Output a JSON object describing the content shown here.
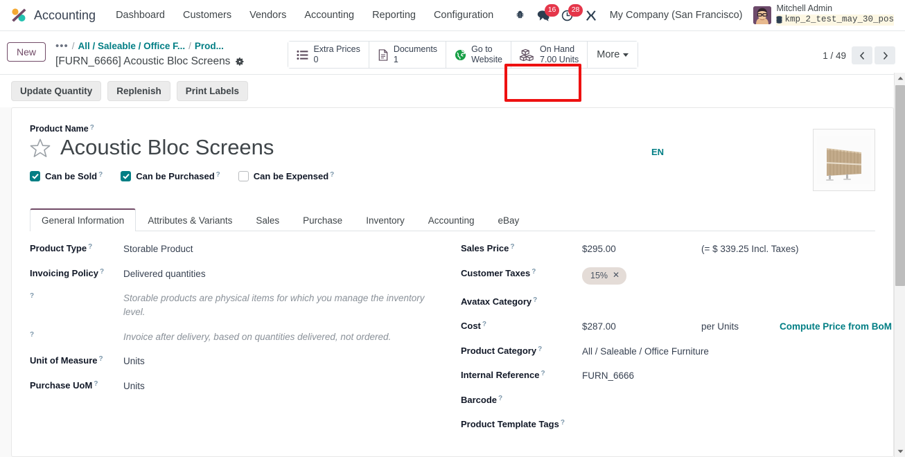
{
  "navbar": {
    "brand": "Accounting",
    "menu_items": [
      "Dashboard",
      "Customers",
      "Vendors",
      "Accounting",
      "Reporting",
      "Configuration"
    ],
    "icons": [
      {
        "name": "bug-icon",
        "badge": null
      },
      {
        "name": "chat-bubble-icon",
        "badge": "16"
      },
      {
        "name": "activity-clock-icon",
        "badge": "28"
      },
      {
        "name": "tools-icon",
        "badge": null
      }
    ],
    "company": "My Company (San Francisco)",
    "user_name": "Mitchell Admin",
    "database": "kmp_2_test_may_30_pos"
  },
  "control_panel": {
    "new_button": "New",
    "breadcrumb": {
      "dots": "•••",
      "items": [
        "All / Saleable / Office F...",
        "Prod..."
      ],
      "separator": "/",
      "record_title": "[FURN_6666] Acoustic Bloc Screens"
    },
    "stat_buttons": [
      {
        "name": "extra-prices",
        "icon": "list-icon",
        "label": "Extra Prices",
        "value": "0"
      },
      {
        "name": "documents",
        "icon": "document-icon",
        "label": "Documents",
        "value": "1"
      },
      {
        "name": "go-to-website",
        "icon": "globe-icon",
        "label": "Go to",
        "value": "Website"
      },
      {
        "name": "on-hand",
        "icon": "boxes-icon",
        "label": "On Hand",
        "value": "7.00 Units"
      }
    ],
    "more_label": "More",
    "pager": {
      "text": "1 / 49",
      "prev": "‹",
      "next": "›"
    }
  },
  "action_bar": {
    "buttons": [
      "Update Quantity",
      "Replenish",
      "Print Labels"
    ]
  },
  "form": {
    "product_name_label": "Product Name",
    "product_name": "Acoustic Bloc Screens",
    "language_badge": "EN",
    "checkboxes": [
      {
        "label": "Can be Sold",
        "checked": true
      },
      {
        "label": "Can be Purchased",
        "checked": true
      },
      {
        "label": "Can be Expensed",
        "checked": false
      }
    ],
    "tabs": [
      {
        "label": "General Information",
        "active": true
      },
      {
        "label": "Attributes & Variants",
        "active": false
      },
      {
        "label": "Sales",
        "active": false
      },
      {
        "label": "Purchase",
        "active": false
      },
      {
        "label": "Inventory",
        "active": false
      },
      {
        "label": "Accounting",
        "active": false
      },
      {
        "label": "eBay",
        "active": false
      }
    ],
    "left_fields": {
      "product_type_label": "Product Type",
      "product_type_value": "Storable Product",
      "invoicing_policy_label": "Invoicing Policy",
      "invoicing_policy_value": "Delivered quantities",
      "help_storable": "Storable products are physical items for which you manage the inventory level.",
      "help_invoice": "Invoice after delivery, based on quantities delivered, not ordered.",
      "uom_label": "Unit of Measure",
      "uom_value": "Units",
      "purchase_uom_label": "Purchase UoM",
      "purchase_uom_value": "Units"
    },
    "right_fields": {
      "sales_price_label": "Sales Price",
      "sales_price_value": "$295.00",
      "sales_price_note": "(= $ 339.25 Incl. Taxes)",
      "customer_taxes_label": "Customer Taxes",
      "customer_taxes_tag": "15%",
      "avatax_label": "Avatax Category",
      "avatax_value": "",
      "cost_label": "Cost",
      "cost_value": "$287.00",
      "cost_per": "per Units",
      "compute_link": "Compute Price from BoM",
      "product_category_label": "Product Category",
      "product_category_value": "All / Saleable / Office Furniture",
      "internal_reference_label": "Internal Reference",
      "internal_reference_value": "FURN_6666",
      "barcode_label": "Barcode",
      "barcode_value": "",
      "tags_label": "Product Template Tags",
      "tags_value": ""
    }
  },
  "colors": {
    "accent_purple": "#714b67",
    "teal_link": "#017e84",
    "badge_red": "#e5364a",
    "highlight_red": "#ee1111",
    "tag_bg": "#e4dcd7"
  }
}
